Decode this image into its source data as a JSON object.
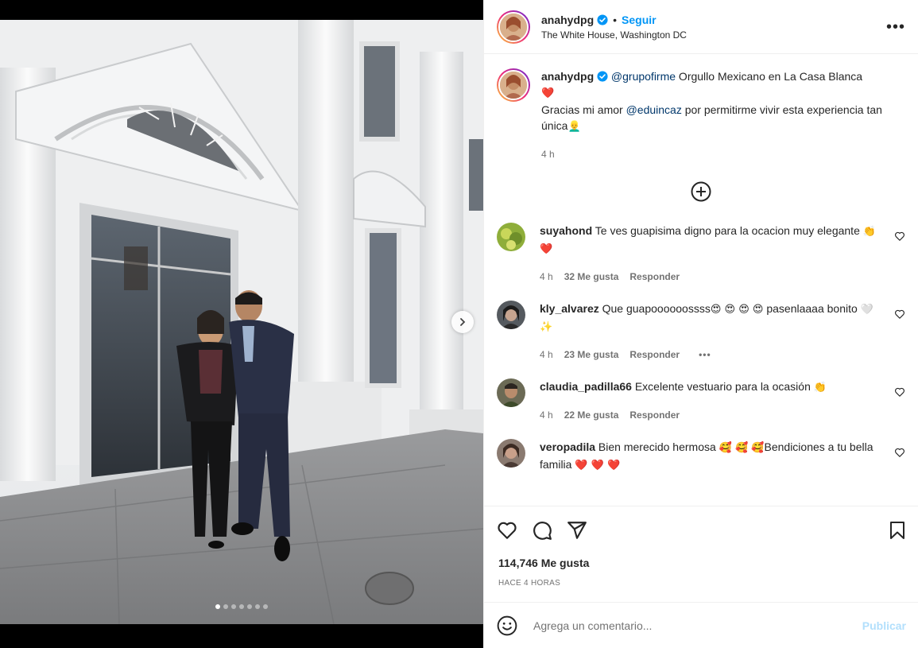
{
  "post": {
    "username": "anahydpg",
    "follow_label": "Seguir",
    "dot": "•",
    "location": "The White House, Washington DC",
    "more_label": "•••"
  },
  "caption": {
    "username": "anahydpg",
    "mention1": "@grupofirme",
    "text1": " Orgullo Mexicano en La Casa Blanca",
    "emoji1": "❤️",
    "text2": "Gracias mi amor ",
    "mention2": "@eduincaz",
    "text3": " por permitirme vivir esta experiencia tan única",
    "emoji2": "👱‍♂️",
    "time": "4 h"
  },
  "comments": [
    {
      "username": "suyahond",
      "text": "Te ves guapisima digno para la ocacion muy elegante ",
      "emoji": "👏 ❤️",
      "time": "4 h",
      "likes": "32 Me gusta",
      "reply": "Responder"
    },
    {
      "username": "kly_alvarez",
      "text": "Que guapoooooossss",
      "emoji_mid": "😍 😍 😍 😍",
      "text2": " pasenlaaaa bonito ",
      "emoji": "🤍 ✨",
      "time": "4 h",
      "likes": "23 Me gusta",
      "reply": "Responder",
      "more": "•••"
    },
    {
      "username": "claudia_padilla66",
      "text": "Excelente vestuario para la ocasión ",
      "emoji": "👏",
      "time": "4 h",
      "likes": "22 Me gusta",
      "reply": "Responder"
    },
    {
      "username": "veropadila",
      "text": "Bien merecido hermosa ",
      "emoji_mid": "🥰 🥰 🥰",
      "text2": "Bendiciones a tu bella familia ",
      "emoji": "❤️ ❤️ ❤️"
    }
  ],
  "likes_label": "114,746 Me gusta",
  "ago_label": "HACE 4 HORAS",
  "add_comment": {
    "placeholder": "Agrega un comentario...",
    "publish_label": "Publicar"
  },
  "carousel": {
    "total": 7,
    "current": 1
  },
  "colors": {
    "accent": "#0095f6",
    "mention": "#00376b",
    "muted": "#737373"
  }
}
